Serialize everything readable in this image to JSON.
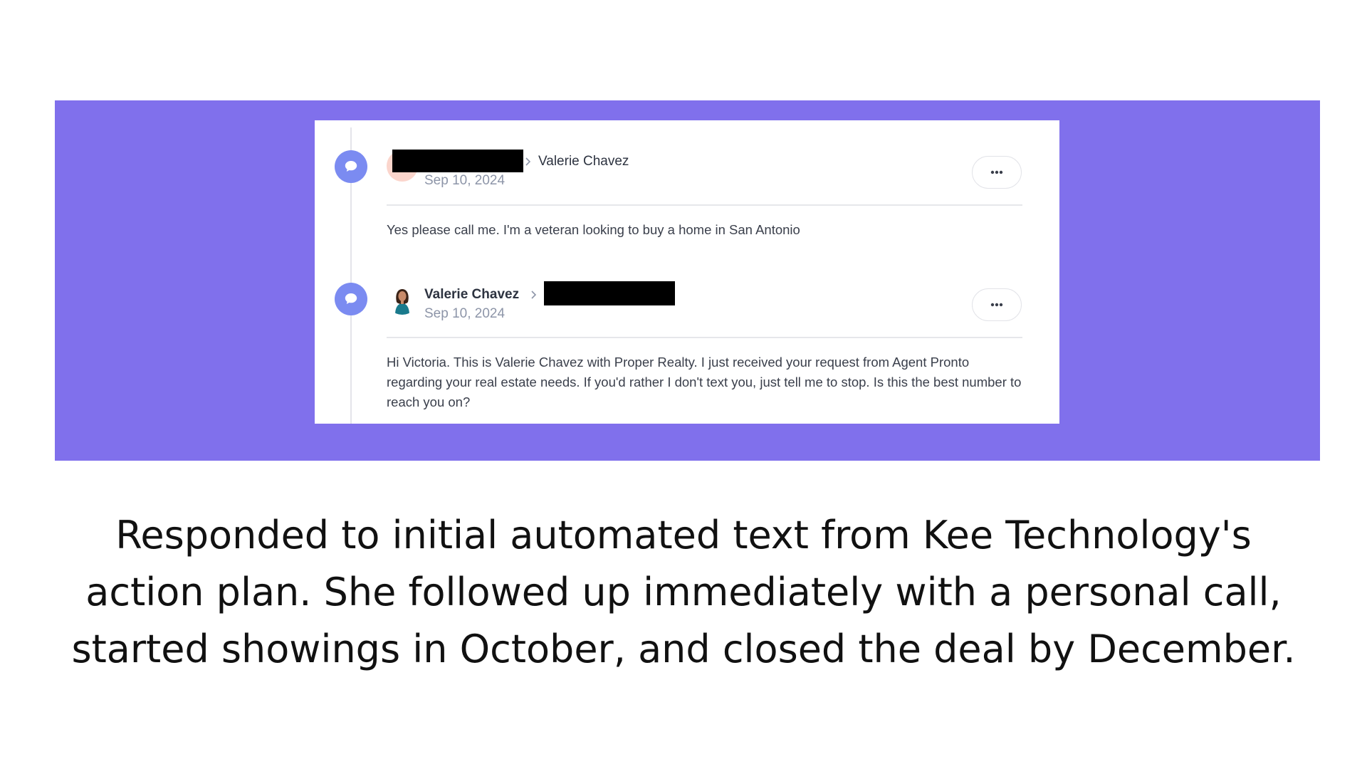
{
  "colors": {
    "banner": "#8070EC",
    "timeline_dot": "#7b8bf1",
    "date_text": "#8d95a8",
    "redaction": "#000000"
  },
  "messages": [
    {
      "sender_redacted": true,
      "recipient": "Valerie Chavez",
      "date": "Sep 10, 2024",
      "body": "Yes please call me. I'm a veteran looking to buy a home in San Antonio",
      "icon": "chat-bubble-icon"
    },
    {
      "sender": "Valerie Chavez",
      "recipient_redacted": true,
      "date": "Sep 10, 2024",
      "body": "Hi Victoria. This is Valerie Chavez with Proper Realty. I just received your request from Agent Pronto regarding your real estate needs. If you'd rather I don't text you, just tell me to stop. Is this the best number to reach you on?",
      "icon": "chat-bubble-icon"
    }
  ],
  "caption": {
    "line1": "Responded to initial automated text from Kee Technology's",
    "line2": "action plan. She followed up immediately with a personal call,",
    "line3": "started showings in October, and closed the deal by December."
  }
}
